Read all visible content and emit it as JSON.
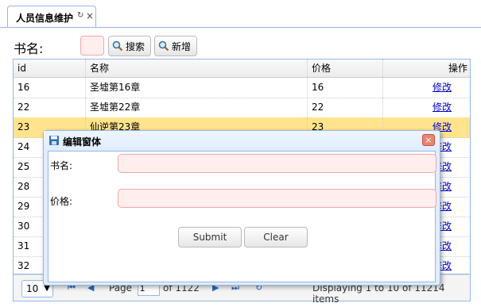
{
  "tab": {
    "title": "人员信息维护",
    "refresh_glyph": "↻",
    "close_glyph": "×"
  },
  "toolbar": {
    "name_label": "书名:",
    "search_label": "搜索",
    "add_label": "新增"
  },
  "grid": {
    "columns": [
      "id",
      "名称",
      "价格",
      "操作"
    ],
    "rows": [
      {
        "id": "16",
        "name": "圣墟第16章",
        "price": "16",
        "action": "修改"
      },
      {
        "id": "22",
        "name": "圣墟第22章",
        "price": "22",
        "action": "修改"
      },
      {
        "id": "23",
        "name": "仙逆第23章",
        "price": "23",
        "action": "修改"
      },
      {
        "id": "24",
        "name": "",
        "price": "",
        "action": "修改"
      },
      {
        "id": "25",
        "name": "",
        "price": "",
        "action": "修改"
      },
      {
        "id": "28",
        "name": "",
        "price": "",
        "action": "修改"
      },
      {
        "id": "29",
        "name": "",
        "price": "",
        "action": "修改"
      },
      {
        "id": "30",
        "name": "",
        "price": "",
        "action": "修改"
      },
      {
        "id": "31",
        "name": "",
        "price": "",
        "action": "修改"
      },
      {
        "id": "32",
        "name": "",
        "price": "",
        "action": "修改"
      }
    ],
    "selected_index": 2
  },
  "pager": {
    "page_size": "10",
    "page_label": "Page",
    "page_value": "1",
    "of_label": "of 1122",
    "display_text": "Displaying 1 to 10 of 11214 items"
  },
  "dialog": {
    "title": "编辑窗体",
    "name_label": "书名:",
    "price_label": "价格:",
    "submit_label": "Submit",
    "clear_label": "Clear"
  },
  "colors": {
    "accent": "#95b8e7",
    "selected_row": "#ffe48d",
    "invalid_input": "#ffeeee"
  }
}
